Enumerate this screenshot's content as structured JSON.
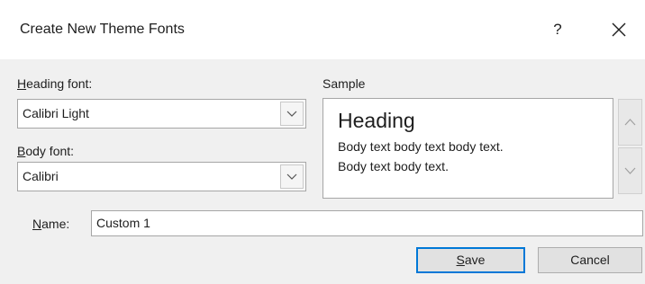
{
  "dialog": {
    "title": "Create New Theme Fonts",
    "help_glyph": "?",
    "close_glyph": "×"
  },
  "heading_font": {
    "label_accel": "H",
    "label_rest": "eading font:",
    "value": "Calibri Light"
  },
  "body_font": {
    "label_accel": "B",
    "label_rest": "ody font:",
    "value": "Calibri"
  },
  "sample": {
    "label": "Sample",
    "heading": "Heading",
    "body_line1": "Body text body text body text.",
    "body_line2": "Body text body text."
  },
  "name": {
    "label_accel": "N",
    "label_rest": "ame:",
    "value": "Custom 1"
  },
  "buttons": {
    "save_accel": "S",
    "save_rest": "ave",
    "cancel": "Cancel"
  },
  "colors": {
    "accent": "#0078d7",
    "panel": "#f0f0f0",
    "border": "#a6a6a6"
  },
  "icons": {
    "close": "close-icon",
    "help": "help-icon",
    "dropdown": "chevron-down-icon",
    "scroll_up": "chevron-up-icon",
    "scroll_down": "chevron-down-icon"
  }
}
